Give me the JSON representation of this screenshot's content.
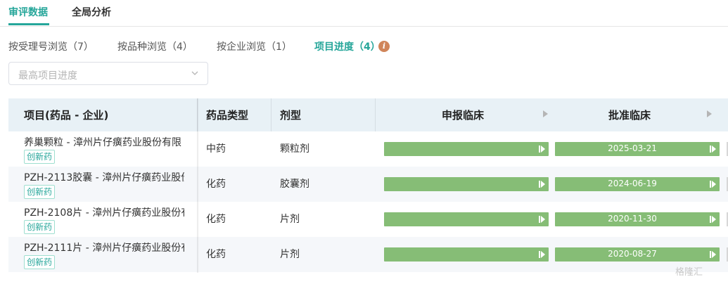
{
  "top_tabs": [
    {
      "label": "审评数据",
      "active": true
    },
    {
      "label": "全局分析",
      "active": false
    }
  ],
  "sub_tabs": [
    {
      "label": "按受理号浏览（7）",
      "active": false
    },
    {
      "label": "按品种浏览（4）",
      "active": false
    },
    {
      "label": "按企业浏览（1）",
      "active": false
    },
    {
      "label": "项目进度（4）",
      "active": true
    }
  ],
  "info_icon": "i",
  "filter": {
    "placeholder": "最高项目进度"
  },
  "table": {
    "headers": {
      "project": "项目(药品 - 企业)",
      "drug_type": "药品类型",
      "dosage_form": "剂型",
      "stage1": "申报临床",
      "stage2": "批准临床"
    },
    "rows": [
      {
        "name": "养巢颗粒 - 漳州片仔癀药业股份有限",
        "badge": "创新药",
        "drug_type": "中药",
        "dosage_form": "颗粒剂",
        "stage1_date": "",
        "stage2_date": "2025-03-21"
      },
      {
        "name": "PZH-2113胶囊 - 漳州片仔癀药业股份",
        "badge": "创新药",
        "drug_type": "化药",
        "dosage_form": "胶囊剂",
        "stage1_date": "",
        "stage2_date": "2024-06-19"
      },
      {
        "name": "PZH-2108片 - 漳州片仔癀药业股份有",
        "badge": "创新药",
        "drug_type": "化药",
        "dosage_form": "片剂",
        "stage1_date": "",
        "stage2_date": "2020-11-30"
      },
      {
        "name": "PZH-2111片 - 漳州片仔癀药业股份有",
        "badge": "创新药",
        "drug_type": "化药",
        "dosage_form": "片剂",
        "stage1_date": "",
        "stage2_date": "2020-08-27"
      }
    ]
  },
  "colors": {
    "accent": "#26a69a",
    "bar": "#86bd76",
    "header_bg": "#e8f1f6",
    "badge_border": "#9fdfd0"
  },
  "watermark": "格隆汇"
}
